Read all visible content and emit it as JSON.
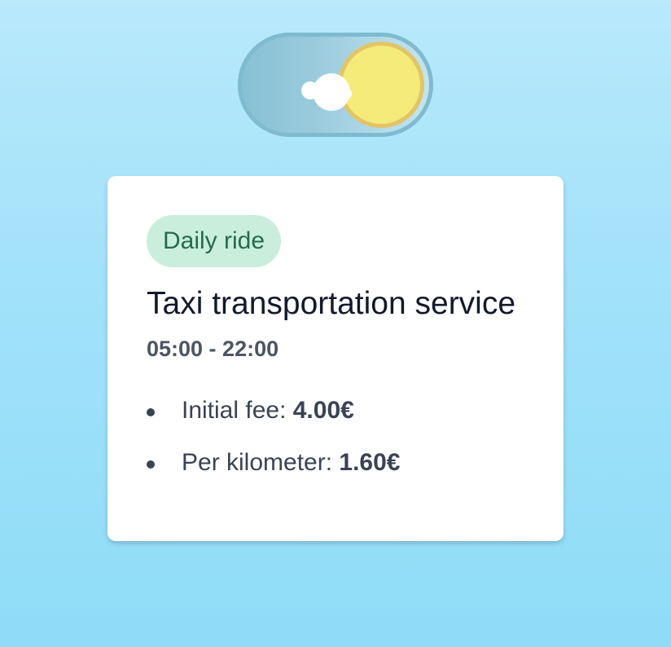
{
  "theme_toggle": {
    "state": "day",
    "colors": {
      "track": "#9acbdc",
      "sun": "#f4eb79",
      "sun_ring": "#e3c465",
      "cloud": "#ffffff"
    },
    "icons": [
      "sun-icon",
      "cloud-icon"
    ]
  },
  "card": {
    "badge": "Daily ride",
    "title": "Taxi transportation service",
    "hours": "05:00 - 22:00",
    "fees": [
      {
        "label": "Initial fee: ",
        "value": "4.00€"
      },
      {
        "label": "Per kilometer: ",
        "value": "1.60€"
      }
    ]
  },
  "colors": {
    "background_top": "#b9e9fb",
    "background_bottom": "#8fdcf8",
    "badge_bg": "#c9eedc",
    "badge_text": "#256b4c",
    "title_text": "#121a2b",
    "body_text": "#3a4354"
  }
}
